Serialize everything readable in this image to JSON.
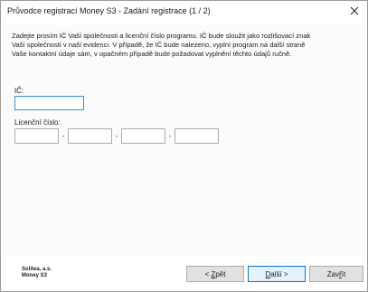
{
  "window": {
    "title": "Průvodce registrací Money S3 - Zadání registrace (1 / 2)",
    "close_glyph": "✕"
  },
  "intro_lines": [
    "Zadejte prosím IČ Vaší společnosti a licenční číslo programu. IČ bude sloužit jako rozlišovací znak",
    "Vaší společnosti v naší evidenci. V případě, že IČ bude nalezeno, vyplní program na další straně",
    "Vaše kontaktní údaje sám, v opačném případě bude požadovat vyplnění těchto údajů ručně."
  ],
  "form": {
    "ic_label": "IČ:",
    "ic_value": "",
    "license_label": "Licenční číslo:",
    "license_separator": "-",
    "license_parts": [
      "",
      "",
      "",
      ""
    ]
  },
  "footer": {
    "company_line1": "Solitea, a.s.",
    "company_line2": "Money S3",
    "back_prefix": "< ",
    "back_accel": "Z",
    "back_rest": "pět",
    "next_prefix": "",
    "next_accel": "D",
    "next_rest": "alší >",
    "close_prefix": "Zav",
    "close_accel": "ř",
    "close_rest": "ít"
  },
  "colors": {
    "focus_border": "#3a8ed6",
    "default_button_border": "#0078d7",
    "button_face": "#e1e1e1"
  }
}
